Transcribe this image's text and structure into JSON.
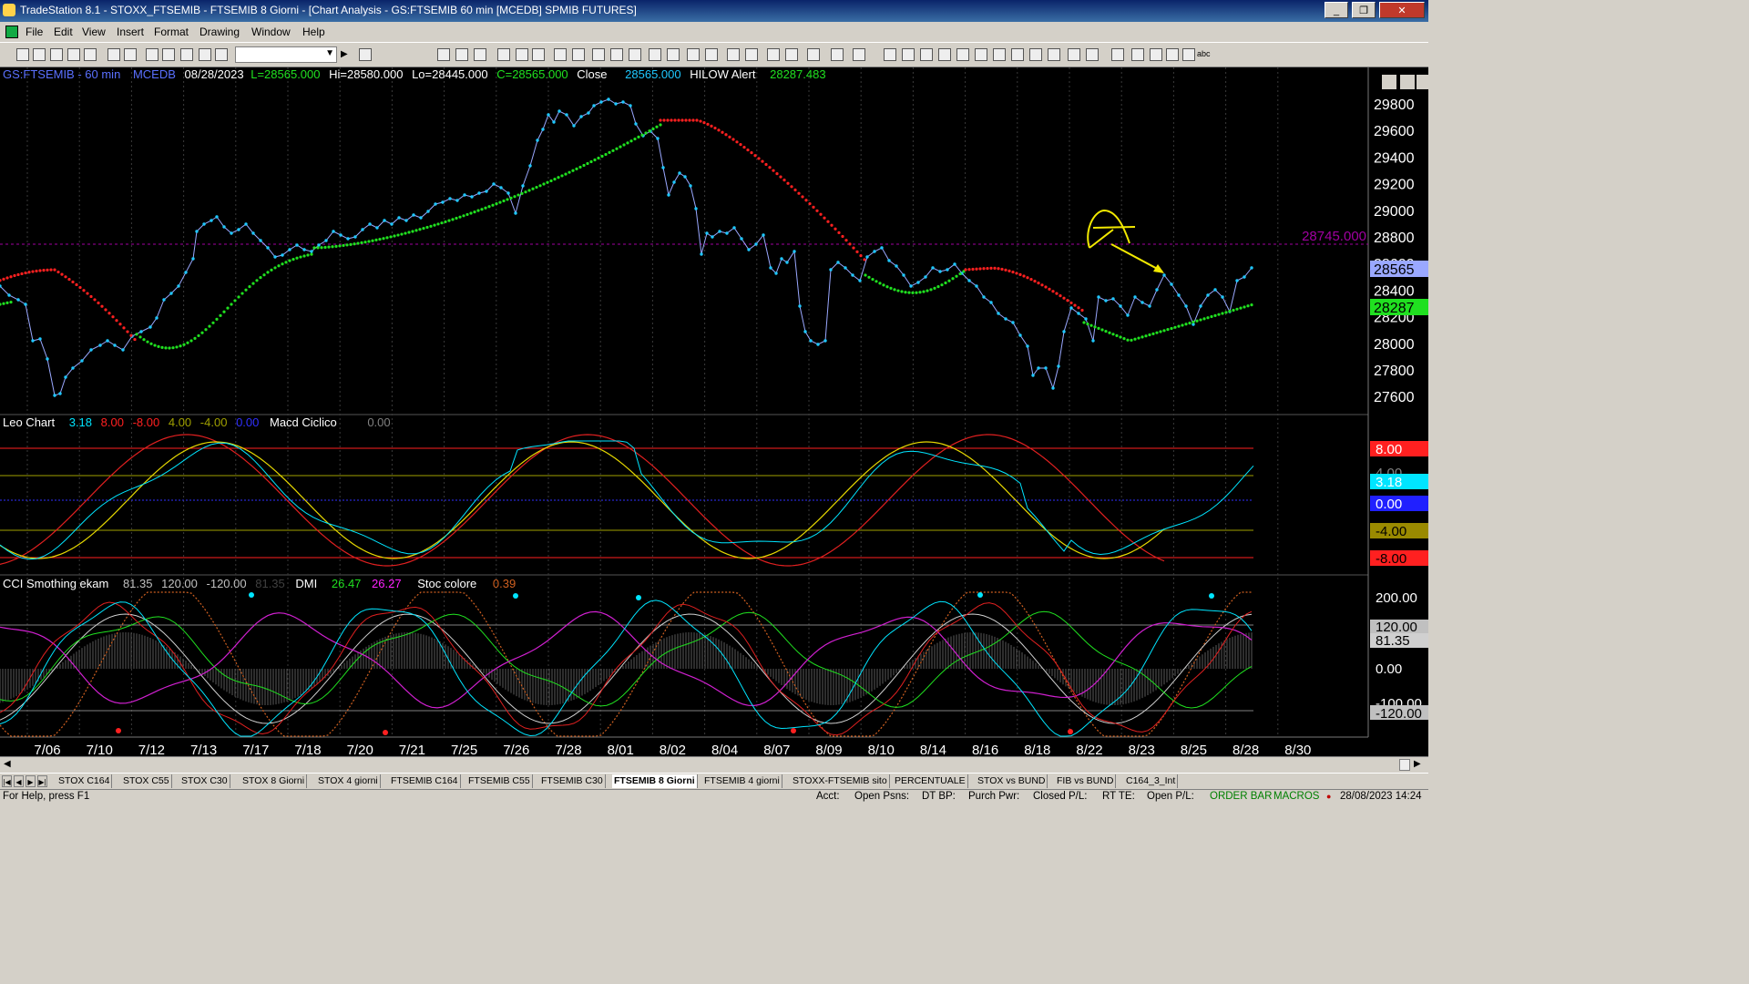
{
  "window": {
    "title": "TradeStation 8.1 - STOXX_FTSEMIB - FTSEMIB  8 Giorni - [Chart Analysis - GS:FTSEMIB  60 min  [MCEDB] SPMIB FUTURES]",
    "buttons": {
      "minimize": "_",
      "restore": "❐",
      "close": "✕"
    },
    "mdi_buttons": {
      "minimize": "–",
      "restore": "❐",
      "close": "×"
    }
  },
  "menu": [
    "File",
    "Edit",
    "View",
    "Insert",
    "Format",
    "Drawing",
    "Window",
    "Help"
  ],
  "toolbar": {
    "combo_value": "",
    "icons": [
      "new-icon",
      "open-icon",
      "save-icon",
      "print-icon",
      "print-preview-icon",
      "insert-chart-icon",
      "insert-grid-icon",
      "lock-icon",
      "paint-icon",
      "globe-icon",
      "format-icon",
      "zoom-in-icon",
      "zoom-out-icon",
      "pointer-icon",
      "crosshair-icon",
      "trendline-icon",
      "horizontal-line-icon",
      "fibonacci-icon",
      "arrow-up-icon",
      "arrow-down-icon",
      "circle-icon",
      "rectangle-icon",
      "text-icon"
    ],
    "abc_label": "abc"
  },
  "chart": {
    "colors": {
      "price": "#9aa8ff",
      "price_dots": "#1ec8ff",
      "hl_red": "#ff2020",
      "hl_green": "#20e020",
      "cyan": "#00e5ff",
      "yellow": "#e6d800",
      "magenta": "#d020d0",
      "alert": "#a000a0"
    },
    "price_header": {
      "symbol": "GS:FTSEMIB - 60 min",
      "db": "MCEDB",
      "date": "08/28/2023",
      "L": "L=28565.000",
      "Hi": "Hi=28580.000",
      "Lo": "Lo=28445.000",
      "C": "C=28565.000",
      "close_label": "Close",
      "close_val": "28565.000",
      "hilow_label": "HILOW Alert",
      "hilow_val": "28287.483"
    },
    "price_axis": [
      "29800",
      "29600",
      "29400",
      "29200",
      "29000",
      "28800",
      "28600",
      "28400",
      "28200",
      "28000",
      "27800",
      "27600"
    ],
    "price_alert_label": "28745.000",
    "price_last": "28565",
    "price_hilow": "28287",
    "macd_header": {
      "name": "Leo Chart",
      "v1": "3.18",
      "v2": "8.00",
      "v3": "-8.00",
      "v4": "4.00",
      "v5": "-4.00",
      "v6": "0.00",
      "name2": "Macd Ciclico",
      "v7": "0.00"
    },
    "macd_axis": {
      "p8": "8.00",
      "p318": "3.18",
      "zero": "0.00",
      "m4": "-4.00",
      "m8": "-8.00",
      "hidden": "4.00"
    },
    "cci_header": {
      "name": "CCI Smothing ekam",
      "v1": "81.35",
      "v2": "120.00",
      "v3": "-120.00",
      "v4": "81.35",
      "dmi": "DMI",
      "dmi1": "26.47",
      "dmi2": "26.27",
      "stoc": "Stoc colore",
      "stoc_val": "0.39"
    },
    "cci_axis": {
      "p200": "200.00",
      "p120": "120.00",
      "p8135": "81.35",
      "zero": "0.00",
      "m100": "-100.00",
      "m120": "-120.00"
    },
    "dates": [
      "7/06",
      "7/10",
      "7/12",
      "7/13",
      "7/17",
      "7/18",
      "7/20",
      "7/21",
      "7/25",
      "7/26",
      "7/28",
      "8/01",
      "8/02",
      "8/04",
      "8/07",
      "8/09",
      "8/10",
      "8/14",
      "8/16",
      "8/18",
      "8/22",
      "8/23",
      "8/25",
      "8/28",
      "8/30"
    ]
  },
  "tabs": {
    "nav": [
      "|◀",
      "◀",
      "▶",
      "▶|"
    ],
    "items": [
      "STOX C164",
      "STOX C55",
      "STOX  C30",
      "STOX  8 Giorni",
      "STOX 4 giorni",
      "FTSEMIB C164",
      "FTSEMIB C55",
      "FTSEMIB C30",
      "FTSEMIB  8 Giorni",
      "FTSEMIB  4 giorni",
      "STOXX-FTSEMIB sito",
      "PERCENTUALE",
      "STOX vs BUND",
      "FIB vs BUND",
      "C164_3_Int"
    ],
    "active": "FTSEMIB  8 Giorni"
  },
  "status": {
    "help": "For Help, press F1",
    "acct": "Acct:",
    "open_psns": "Open Psns:",
    "dt_bp": "DT BP:",
    "purch_pwr": "Purch Pwr:",
    "closed_pl": "Closed P/L:",
    "rt_te": "RT TE:",
    "open_pl": "Open P/L:",
    "order_bar": "ORDER BAR",
    "macros": "MACROS",
    "datetime": "28/08/2023 14:24"
  }
}
